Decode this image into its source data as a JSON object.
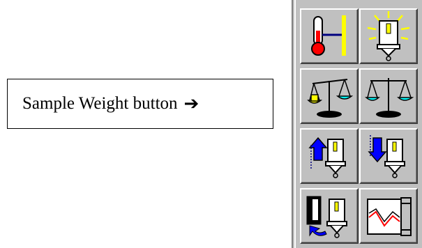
{
  "callout": {
    "label": "Sample Weight button",
    "arrow": "➔"
  },
  "toolbar": {
    "buttons": [
      {
        "icon": "thermometer-icon",
        "name": "temperature-button"
      },
      {
        "icon": "lamp-light-icon",
        "name": "light-button"
      },
      {
        "icon": "sample-weight-icon",
        "name": "sample-weight-button"
      },
      {
        "icon": "balance-scale-icon",
        "name": "balance-button"
      },
      {
        "icon": "raise-sample-icon",
        "name": "raise-button"
      },
      {
        "icon": "lower-sample-icon",
        "name": "lower-button"
      },
      {
        "icon": "load-sample-icon",
        "name": "load-button"
      },
      {
        "icon": "furnace-graph-icon",
        "name": "furnace-button"
      }
    ],
    "colors": {
      "face": "#c0c0c0",
      "red": "#ff0000",
      "blue": "#0000ff",
      "yellow": "#ffff00",
      "navy": "#000080"
    }
  }
}
